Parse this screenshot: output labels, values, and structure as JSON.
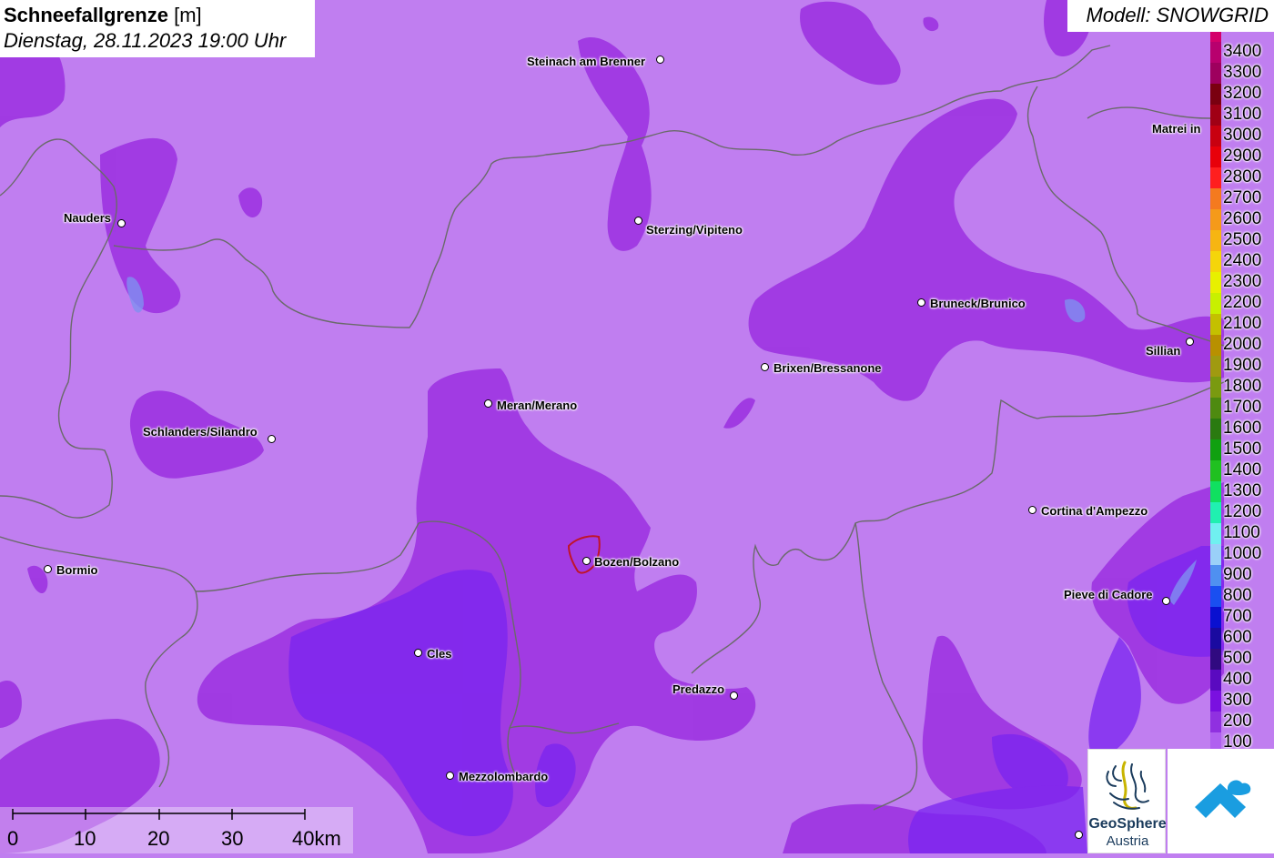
{
  "header": {
    "title": "Schneefallgrenze",
    "unit": "[m]",
    "datetime": "Dienstag, 28.11.2023 19:00 Uhr"
  },
  "model": "Modell: SNOWGRID",
  "legend": {
    "levels": [
      "3400",
      "3300",
      "3200",
      "3100",
      "3000",
      "2900",
      "2800",
      "2700",
      "2600",
      "2500",
      "2400",
      "2300",
      "2200",
      "2100",
      "2000",
      "1900",
      "1800",
      "1700",
      "1600",
      "1500",
      "1400",
      "1300",
      "1200",
      "1100",
      "1000",
      "900",
      "800",
      "700",
      "600",
      "500",
      "400",
      "300",
      "200",
      "100"
    ],
    "colors": [
      "#d4006a",
      "#b8006e",
      "#9e005e",
      "#7a0010",
      "#a00015",
      "#c80010",
      "#e8000a",
      "#ff1f1f",
      "#f47a1f",
      "#f59a1a",
      "#f7b512",
      "#f5d50a",
      "#e8f000",
      "#c8f000",
      "#c4c000",
      "#b89000",
      "#a09a10",
      "#7a9a10",
      "#4e8a10",
      "#2a7a10",
      "#10a010",
      "#20c020",
      "#10e060",
      "#20f0b0",
      "#70f0f0",
      "#9ad0f8",
      "#4f90f0",
      "#1a4ff0",
      "#0a10d0",
      "#1a0aa0",
      "#300a80",
      "#5a0ac0",
      "#7a10e0",
      "#9030e0",
      "#b060f0"
    ]
  },
  "cities": [
    {
      "name": "Steinach am Brenner"
    },
    {
      "name": "Matrei in"
    },
    {
      "name": "Nauders"
    },
    {
      "name": "Sterzing/Vipiteno"
    },
    {
      "name": "Bruneck/Brunico"
    },
    {
      "name": "Sillian"
    },
    {
      "name": "Brixen/Bressanone"
    },
    {
      "name": "Meran/Merano"
    },
    {
      "name": "Schlanders/Silandro"
    },
    {
      "name": "Cortina d'Ampezzo"
    },
    {
      "name": "Bormio"
    },
    {
      "name": "Bozen/Bolzano"
    },
    {
      "name": "Pieve di Cadore"
    },
    {
      "name": "Cles"
    },
    {
      "name": "Predazzo"
    },
    {
      "name": "Mezzolombardo"
    }
  ],
  "scalebar": {
    "labels": [
      "0",
      "10",
      "20",
      "30",
      "40km"
    ]
  },
  "logos": {
    "geosphere_line1": "GeoSphere",
    "geosphere_line2": "Austria"
  },
  "colors": {
    "base_map": "#c07ef0",
    "zone_200": "#9b2fe0",
    "zone_300": "#7a24f0",
    "border": "#6a6a6a"
  }
}
